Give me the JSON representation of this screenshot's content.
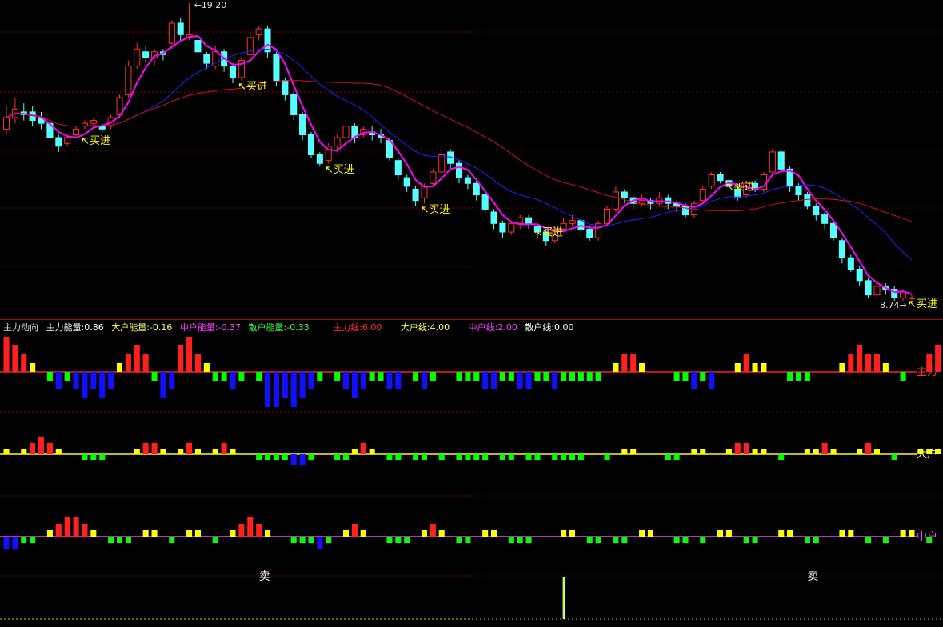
{
  "info": {
    "title": "主力动向",
    "zl_energy": "主力能量:0.86",
    "dh_energy": "大户能量:-0.16",
    "zh_energy": "中户能量:-0.37",
    "sh_energy": "散户能量:-0.33",
    "zl_line": "主力线:6.00",
    "dh_line": "大户线:4.00",
    "zh_line": "中户线:2.00",
    "sh_line": "散户线:0.00"
  },
  "labels": {
    "high": "19.20",
    "low": "8.74",
    "buy": "买进",
    "sell": "卖",
    "zl": "主力",
    "dh": "大户",
    "zh": "中户"
  },
  "colors": {
    "up": "#ff3030",
    "down": "#54ffff",
    "ma_fast": "#ff00ff",
    "ma_mid": "#2020ff",
    "ma_slow": "#d01010",
    "buy_text": "#ffff00",
    "bar_red": "#ff2020",
    "bar_yellow": "#ffff00",
    "bar_blue": "#1010ff",
    "bar_green": "#00ff00",
    "grid": "#8a0000"
  },
  "chart_data": {
    "type": "candlestick",
    "price_range": [
      8.74,
      19.2
    ],
    "candles": [
      [
        14.8,
        15.2,
        15.6,
        14.6
      ],
      [
        15.2,
        15.5,
        15.9,
        15.0
      ],
      [
        15.4,
        15.3,
        15.7,
        15.1
      ],
      [
        15.4,
        15.1,
        15.6,
        14.9
      ],
      [
        15.2,
        15.0,
        15.4,
        14.8
      ],
      [
        15.0,
        14.5,
        15.1,
        14.4
      ],
      [
        14.5,
        14.2,
        14.6,
        14.0
      ],
      [
        14.3,
        14.5,
        14.6,
        14.2
      ],
      [
        14.6,
        14.8,
        14.9,
        14.5
      ],
      [
        14.9,
        15.0,
        15.1,
        14.8
      ],
      [
        15.0,
        15.1,
        15.2,
        14.9
      ],
      [
        14.9,
        14.8,
        15.0,
        14.7
      ],
      [
        14.9,
        15.2,
        15.3,
        14.8
      ],
      [
        15.3,
        15.9,
        16.0,
        15.2
      ],
      [
        16.0,
        17.0,
        17.2,
        15.9
      ],
      [
        17.0,
        17.6,
        17.8,
        16.9
      ],
      [
        17.5,
        17.3,
        17.7,
        17.1
      ],
      [
        17.3,
        17.5,
        17.6,
        17.0
      ],
      [
        17.5,
        17.4,
        17.6,
        17.2
      ],
      [
        17.8,
        18.5,
        18.6,
        17.6
      ],
      [
        18.5,
        18.1,
        18.7,
        17.9
      ],
      [
        18.0,
        18.1,
        19.2,
        17.9
      ],
      [
        17.9,
        17.5,
        18.0,
        17.2
      ],
      [
        17.4,
        17.1,
        17.5,
        16.9
      ],
      [
        17.0,
        17.5,
        17.7,
        16.9
      ],
      [
        17.5,
        17.0,
        17.6,
        16.8
      ],
      [
        17.0,
        16.6,
        17.1,
        16.4
      ],
      [
        16.6,
        17.2,
        17.3,
        16.5
      ],
      [
        17.4,
        18.0,
        18.2,
        17.3
      ],
      [
        18.1,
        18.3,
        18.4,
        17.9
      ],
      [
        18.3,
        17.5,
        18.4,
        17.3
      ],
      [
        17.4,
        16.5,
        17.5,
        16.3
      ],
      [
        16.5,
        16.0,
        16.6,
        15.8
      ],
      [
        16.0,
        15.3,
        16.1,
        15.1
      ],
      [
        15.3,
        14.6,
        15.4,
        14.4
      ],
      [
        14.6,
        13.9,
        14.7,
        13.8
      ],
      [
        13.9,
        13.6,
        14.0,
        13.5
      ],
      [
        13.7,
        14.2,
        14.3,
        13.6
      ],
      [
        14.2,
        14.5,
        14.6,
        14.0
      ],
      [
        14.5,
        14.9,
        15.1,
        14.4
      ],
      [
        14.9,
        14.5,
        15.0,
        14.3
      ],
      [
        14.6,
        14.8,
        14.9,
        14.5
      ],
      [
        14.7,
        14.6,
        14.9,
        14.4
      ],
      [
        14.6,
        14.5,
        14.8,
        14.3
      ],
      [
        14.4,
        13.8,
        14.5,
        13.7
      ],
      [
        13.7,
        13.2,
        13.8,
        13.0
      ],
      [
        13.1,
        12.8,
        13.2,
        12.6
      ],
      [
        12.7,
        12.3,
        12.8,
        12.1
      ],
      [
        12.4,
        12.8,
        12.9,
        12.2
      ],
      [
        12.9,
        13.3,
        13.4,
        12.8
      ],
      [
        13.3,
        13.9,
        14.0,
        13.2
      ],
      [
        14.0,
        13.6,
        14.1,
        13.4
      ],
      [
        13.6,
        13.1,
        13.7,
        12.9
      ],
      [
        13.1,
        12.9,
        13.2,
        12.7
      ],
      [
        12.9,
        12.5,
        13.0,
        12.3
      ],
      [
        12.5,
        12.0,
        12.6,
        11.8
      ],
      [
        11.9,
        11.5,
        12.0,
        11.3
      ],
      [
        11.5,
        11.2,
        11.6,
        11.0
      ],
      [
        11.2,
        11.5,
        11.6,
        11.1
      ],
      [
        11.5,
        11.7,
        11.8,
        11.3
      ],
      [
        11.7,
        11.5,
        11.8,
        11.3
      ],
      [
        11.4,
        11.2,
        11.5,
        11.0
      ],
      [
        11.2,
        10.9,
        11.3,
        10.7
      ],
      [
        10.9,
        11.3,
        11.4,
        10.8
      ],
      [
        11.3,
        11.5,
        11.7,
        11.2
      ],
      [
        11.5,
        11.6,
        11.8,
        11.4
      ],
      [
        11.6,
        11.3,
        11.7,
        11.1
      ],
      [
        11.3,
        11.0,
        11.4,
        10.9
      ],
      [
        11.0,
        11.5,
        11.6,
        10.9
      ],
      [
        11.5,
        12.0,
        12.1,
        11.4
      ],
      [
        12.0,
        12.6,
        12.8,
        11.9
      ],
      [
        12.6,
        12.4,
        12.7,
        12.2
      ],
      [
        12.4,
        12.2,
        12.5,
        12.0
      ],
      [
        12.2,
        12.3,
        12.5,
        12.1
      ],
      [
        12.3,
        12.2,
        12.4,
        12.0
      ],
      [
        12.2,
        12.4,
        12.6,
        12.1
      ],
      [
        12.4,
        12.2,
        12.5,
        12.0
      ],
      [
        12.2,
        12.1,
        12.3,
        11.9
      ],
      [
        12.1,
        11.8,
        12.2,
        11.7
      ],
      [
        11.8,
        12.2,
        12.3,
        11.7
      ],
      [
        12.3,
        12.7,
        12.8,
        12.2
      ],
      [
        12.8,
        13.2,
        13.3,
        12.7
      ],
      [
        13.2,
        13.0,
        13.3,
        12.9
      ],
      [
        13.0,
        12.8,
        13.1,
        12.6
      ],
      [
        12.7,
        12.4,
        12.8,
        12.3
      ],
      [
        12.5,
        12.9,
        13.0,
        12.4
      ],
      [
        12.9,
        12.7,
        13.0,
        12.6
      ],
      [
        12.7,
        13.2,
        13.3,
        12.6
      ],
      [
        13.3,
        14.0,
        14.1,
        13.2
      ],
      [
        14.0,
        13.4,
        14.1,
        13.2
      ],
      [
        13.4,
        12.8,
        13.5,
        12.6
      ],
      [
        12.8,
        12.5,
        12.9,
        12.3
      ],
      [
        12.5,
        12.1,
        12.6,
        12.0
      ],
      [
        12.1,
        11.8,
        12.2,
        11.6
      ],
      [
        11.8,
        11.5,
        11.9,
        11.3
      ],
      [
        11.5,
        11.0,
        11.6,
        10.9
      ],
      [
        10.9,
        10.3,
        11.0,
        10.1
      ],
      [
        10.3,
        9.9,
        10.4,
        9.8
      ],
      [
        9.9,
        9.5,
        10.0,
        9.3
      ],
      [
        9.5,
        9.0,
        9.6,
        8.9
      ],
      [
        9.0,
        9.3,
        9.4,
        8.9
      ],
      [
        9.3,
        9.2,
        9.4,
        9.0
      ],
      [
        9.2,
        8.9,
        9.3,
        8.8
      ],
      [
        8.9,
        9.1,
        9.2,
        8.8
      ],
      [
        8.9,
        8.9,
        9.0,
        8.8
      ]
    ],
    "energy_bars": {
      "zl": [
        4,
        3,
        2,
        1,
        0,
        -1,
        -2,
        -1,
        -2,
        -3,
        -2,
        -3,
        -2,
        1,
        2,
        3,
        2,
        -1,
        -3,
        -2,
        3,
        4,
        2,
        1,
        -1,
        -1,
        -2,
        -1,
        0,
        -1,
        -4,
        -4,
        -3,
        -4,
        -3,
        -2,
        -1,
        0,
        -1,
        -2,
        -3,
        -2,
        -1,
        -1,
        -2,
        -2,
        0,
        -1,
        -2,
        -1,
        0,
        0,
        -1,
        -1,
        -1,
        -2,
        -2,
        -1,
        -1,
        -2,
        -2,
        -1,
        -1,
        -2,
        -1,
        -1,
        -1,
        -1,
        -1,
        0,
        1,
        2,
        2,
        1,
        0,
        0,
        0,
        -1,
        -1,
        -2,
        -1,
        -2,
        0,
        0,
        1,
        2,
        1,
        1,
        0,
        0,
        -1,
        -1,
        -1,
        0,
        0,
        0,
        1,
        2,
        3,
        2,
        2,
        1,
        0,
        -1,
        0,
        0,
        2,
        3,
        2,
        0,
        -2,
        -1,
        3
      ],
      "dh": [
        1,
        0,
        1,
        2,
        3,
        2,
        1,
        0,
        0,
        -1,
        -1,
        -1,
        0,
        0,
        0,
        1,
        2,
        2,
        1,
        0,
        1,
        2,
        1,
        0,
        1,
        2,
        1,
        0,
        0,
        -1,
        -1,
        -1,
        -1,
        -2,
        -2,
        -1,
        0,
        0,
        -1,
        -1,
        1,
        2,
        1,
        0,
        -1,
        -1,
        0,
        -1,
        -1,
        0,
        -1,
        0,
        -1,
        -1,
        -1,
        -1,
        0,
        -1,
        -1,
        0,
        -1,
        -1,
        0,
        -1,
        -1,
        -1,
        -1,
        0,
        0,
        -1,
        0,
        1,
        1,
        0,
        0,
        0,
        -1,
        -1,
        0,
        1,
        1,
        0,
        0,
        1,
        2,
        2,
        1,
        1,
        0,
        -1,
        0,
        0,
        1,
        1,
        2,
        1,
        0,
        0,
        1,
        2,
        1,
        0,
        -1,
        0,
        0,
        1,
        1,
        1
      ],
      "zh": [
        -2,
        -2,
        -1,
        -1,
        0,
        1,
        2,
        3,
        3,
        2,
        1,
        0,
        -1,
        -1,
        -1,
        0,
        1,
        1,
        0,
        -1,
        0,
        1,
        1,
        0,
        -1,
        0,
        1,
        2,
        3,
        2,
        1,
        0,
        0,
        -1,
        -1,
        -1,
        -2,
        -1,
        0,
        1,
        2,
        1,
        0,
        0,
        -1,
        -1,
        -1,
        0,
        1,
        2,
        1,
        0,
        -1,
        -1,
        0,
        1,
        1,
        0,
        -1,
        -1,
        -1,
        0,
        0,
        0,
        1,
        1,
        0,
        -1,
        -1,
        0,
        -1,
        -1,
        0,
        1,
        1,
        0,
        0,
        -1,
        -1,
        0,
        -1,
        0,
        1,
        1,
        0,
        -1,
        -1,
        0,
        0,
        1,
        1,
        0,
        -1,
        -1,
        0,
        0,
        1,
        1,
        0,
        -1,
        0,
        -1,
        0,
        1,
        1,
        0,
        -1
      ]
    }
  }
}
